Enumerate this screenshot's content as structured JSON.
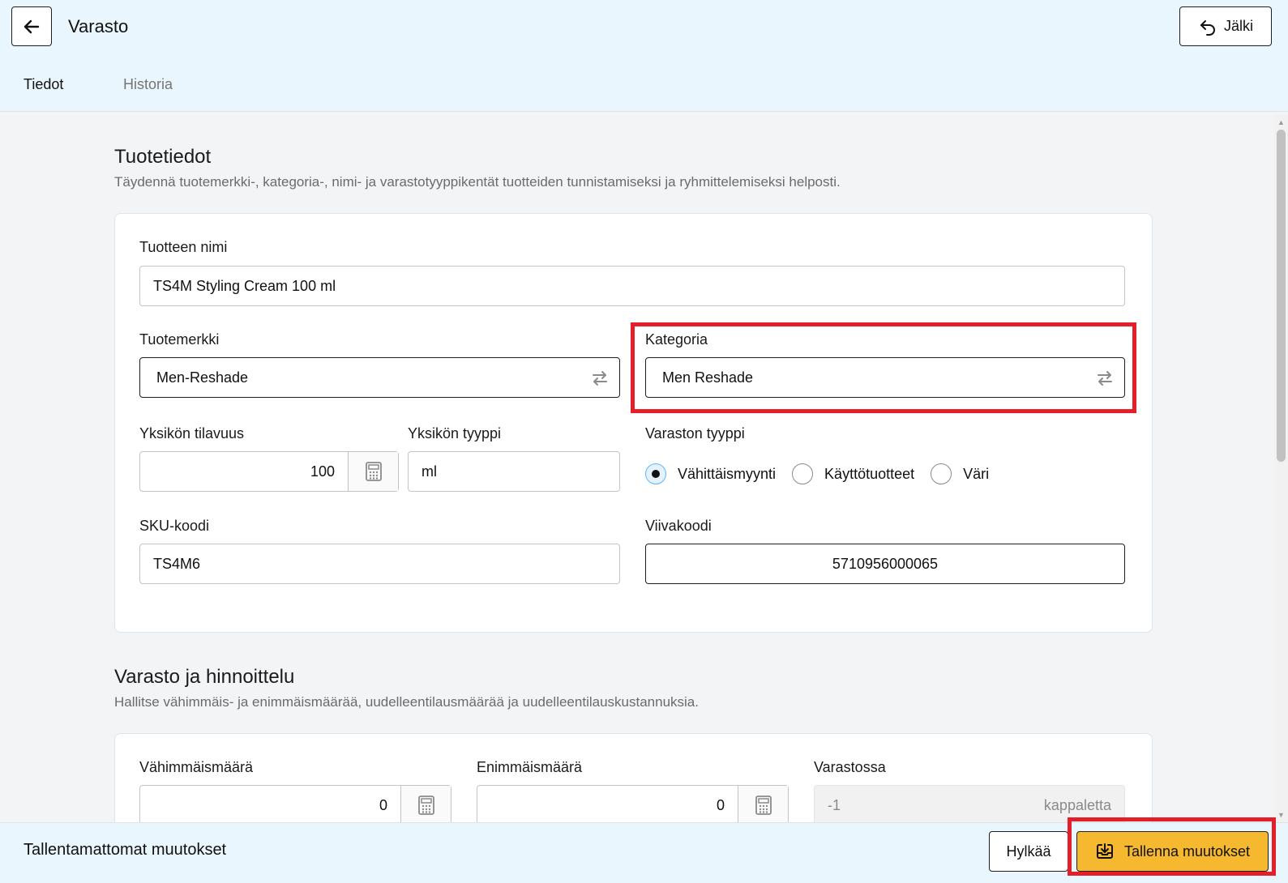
{
  "header": {
    "title": "Varasto",
    "undo_label": "Jälki",
    "tabs": [
      {
        "label": "Tiedot",
        "active": true
      },
      {
        "label": "Historia",
        "active": false
      }
    ]
  },
  "product_section": {
    "title": "Tuotetiedot",
    "description": "Täydennä tuotemerkki-, kategoria-, nimi- ja varastotyyppikentät tuotteiden tunnistamiseksi ja ryhmittelemiseksi helposti.",
    "name_label": "Tuotteen nimi",
    "name_value": "TS4M Styling Cream 100 ml",
    "brand_label": "Tuotemerkki",
    "brand_value": "Men-Reshade",
    "category_label": "Kategoria",
    "category_value": "Men Reshade",
    "unit_volume_label": "Yksikön tilavuus",
    "unit_volume_value": "100",
    "unit_type_label": "Yksikön tyyppi",
    "unit_type_value": "ml",
    "stock_type_label": "Varaston tyyppi",
    "stock_types": [
      {
        "label": "Vähittäismyynti",
        "checked": true
      },
      {
        "label": "Käyttötuotteet",
        "checked": false
      },
      {
        "label": "Väri",
        "checked": false
      }
    ],
    "sku_label": "SKU-koodi",
    "sku_value": "TS4M6",
    "barcode_label": "Viivakoodi",
    "barcode_value": "5710956000065"
  },
  "stock_section": {
    "title": "Varasto ja hinnoittelu",
    "description": "Hallitse vähimmäis- ja enimmäismäärää, uudelleentilausmäärää ja uudelleentilauskustannuksia.",
    "min_label": "Vähimmäismäärä",
    "min_value": "0",
    "max_label": "Enimmäismäärä",
    "max_value": "0",
    "in_stock_label": "Varastossa",
    "in_stock_value": "-1",
    "in_stock_unit": "kappaletta"
  },
  "footer": {
    "unsaved_text": "Tallentamattomat muutokset",
    "cancel_label": "Hylkää",
    "save_label": "Tallenna muutokset"
  },
  "colors": {
    "header_bg": "#eaf6fd",
    "save_button": "#f5b82e",
    "highlight": "#e51f2a",
    "radio_checked": "#64b5f6"
  }
}
